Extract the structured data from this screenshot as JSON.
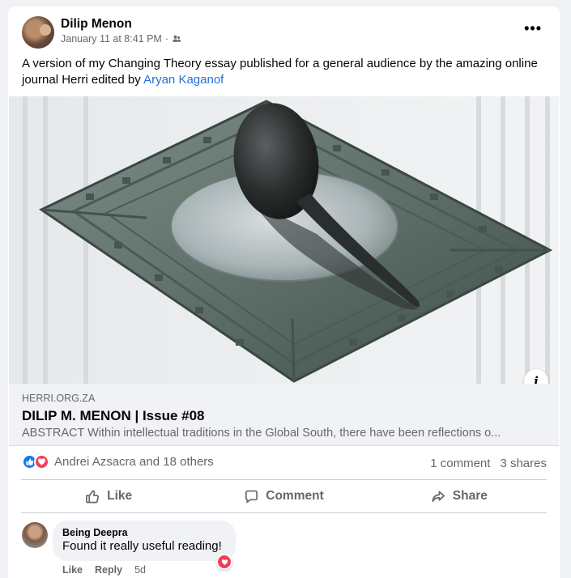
{
  "post": {
    "author": "Dilip Menon",
    "timestamp": "January 11 at 8:41 PM",
    "separator": "·",
    "audience_icon": "friends-icon",
    "text_main": "A version of my Changing Theory essay published for a general audience by the amazing online journal Herri edited by ",
    "text_mention": "Aryan Kaganof",
    "more_icon": "more-horizontal-icon",
    "more_label": "•••"
  },
  "link_preview": {
    "image_alt": "Ancient Chinese south-pointing spoon compass on a bronze diviner's board",
    "domain": "HERRI.ORG.ZA",
    "title": "DILIP M. MENON | Issue #08",
    "description": "ABSTRACT Within intellectual traditions in the Global South, there have been reflections o...",
    "info_label": "i"
  },
  "reactions": {
    "names": "Andrei Azsacra and 18 others",
    "comments": "1 comment",
    "shares": "3 shares"
  },
  "actions": {
    "like": "Like",
    "comment": "Comment",
    "share": "Share"
  },
  "comment": {
    "author": "Being Deepra",
    "text": "Found it really useful reading!",
    "like": "Like",
    "reply": "Reply",
    "age": "5d"
  },
  "colors": {
    "link": "#216fdb",
    "like_blue": "#1877f2",
    "love_red": "#f33e58",
    "muted": "#65676b"
  }
}
